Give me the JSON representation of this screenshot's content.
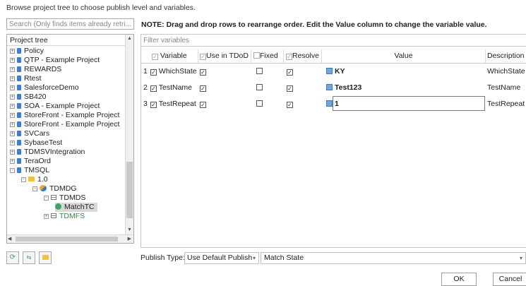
{
  "intro_text": "Browse project tree to choose publish level and variables.",
  "search": {
    "placeholder": "Search (Only finds items already retri..."
  },
  "note": "NOTE: Drag and drop rows to rearrange order. Edit the Value column to change the variable value.",
  "tree": {
    "header": "Project tree",
    "items": [
      {
        "label": "Policy",
        "icon": "database-icon",
        "expander": "+"
      },
      {
        "label": "QTP - Example Project",
        "icon": "database-icon",
        "expander": "+"
      },
      {
        "label": "REWARDS",
        "icon": "database-icon",
        "expander": "+"
      },
      {
        "label": "Rtest",
        "icon": "database-icon",
        "expander": "+"
      },
      {
        "label": "SalesforceDemo",
        "icon": "database-icon",
        "expander": "+"
      },
      {
        "label": "SB420",
        "icon": "database-icon",
        "expander": "+"
      },
      {
        "label": "SOA - Example Project",
        "icon": "database-icon",
        "expander": "+"
      },
      {
        "label": "StoreFront - Example Project",
        "icon": "database-icon",
        "expander": "+"
      },
      {
        "label": "StoreFront - Example Project",
        "icon": "database-icon",
        "expander": "+"
      },
      {
        "label": "SVCars",
        "icon": "database-icon",
        "expander": "+"
      },
      {
        "label": "SybaseTest",
        "icon": "database-icon",
        "expander": "+"
      },
      {
        "label": "TDMSVIntegration",
        "icon": "database-icon",
        "expander": "+"
      },
      {
        "label": "TeraOrd",
        "icon": "database-icon",
        "expander": "+"
      },
      {
        "label": "TMSQL",
        "icon": "database-icon",
        "expander": "-"
      },
      {
        "label": "1.0",
        "icon": "folder-icon",
        "expander": "-"
      },
      {
        "label": "TDMDG",
        "icon": "datagroup-icon",
        "expander": "-"
      },
      {
        "label": "TDMDS",
        "icon": "table-icon",
        "expander": "-"
      },
      {
        "label": "MatchTC",
        "icon": "testcase-icon",
        "expander": ""
      },
      {
        "label": "TDMFS",
        "icon": "table-icon",
        "expander": "+"
      }
    ]
  },
  "grid": {
    "filter_placeholder": "Filter variables",
    "headers": {
      "variable": "Variable",
      "use_in_tdod": "Use in TDoD",
      "fixed": "Fixed",
      "resolve": "Resolve",
      "value": "Value",
      "description": "Description"
    },
    "rows": [
      {
        "num": "1",
        "variable": "WhichState",
        "use_in_tdod": true,
        "fixed": false,
        "resolve": true,
        "value": "KY",
        "description": "WhichState"
      },
      {
        "num": "2",
        "variable": "TestName",
        "use_in_tdod": true,
        "fixed": false,
        "resolve": true,
        "value": "Test123",
        "description": "TestName"
      },
      {
        "num": "3",
        "variable": "TestRepeat",
        "use_in_tdod": true,
        "fixed": false,
        "resolve": true,
        "value": "1",
        "description": "TestRepeat"
      }
    ]
  },
  "publish": {
    "label": "Publish Type:",
    "type_value": "Use Default Publish",
    "match_value": "Match State"
  },
  "buttons": {
    "ok": "OK",
    "cancel": "Cancel"
  }
}
